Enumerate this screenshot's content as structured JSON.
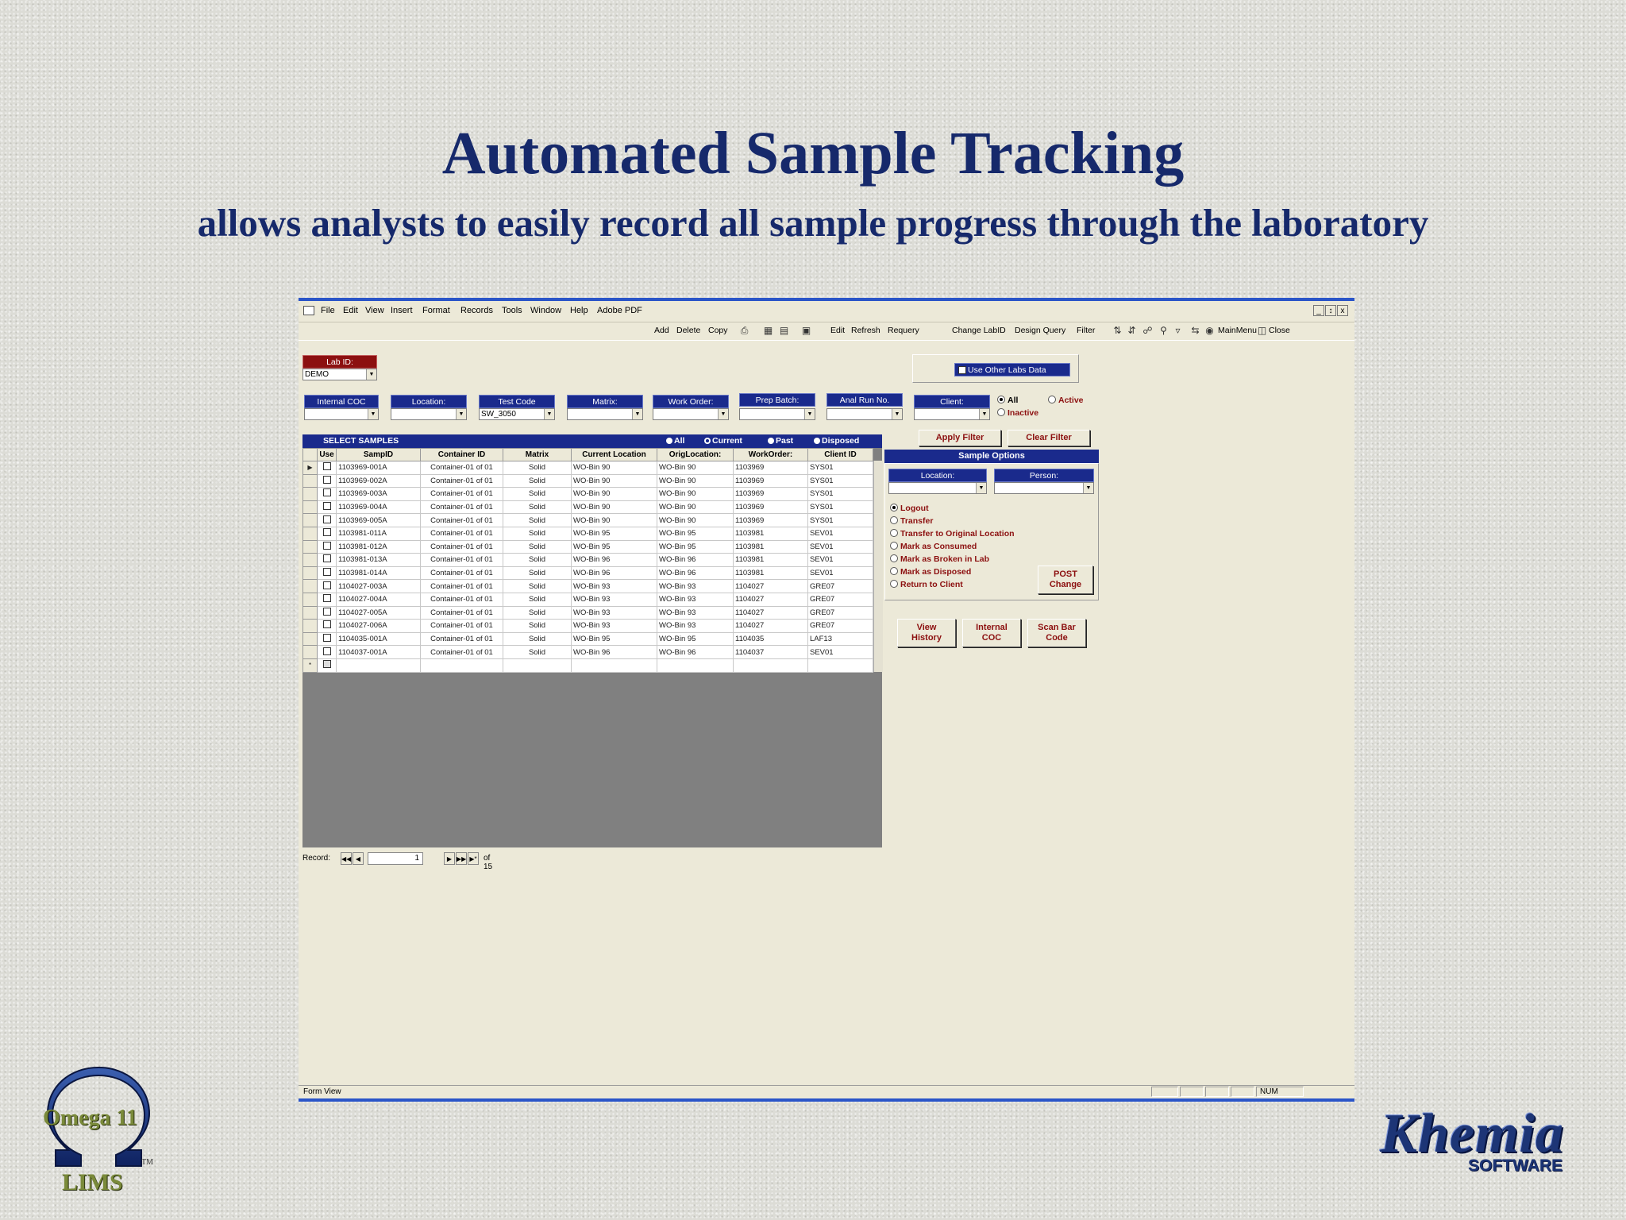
{
  "slide": {
    "title": "Automated Sample Tracking",
    "subtitle": "allows analysts to easily record all sample progress through the laboratory"
  },
  "menu": [
    "File",
    "Edit",
    "View",
    "Insert",
    "Format",
    "Records",
    "Tools",
    "Window",
    "Help",
    "Adobe PDF"
  ],
  "window_controls": [
    "_",
    "↕",
    "x"
  ],
  "toolbar": {
    "add": "Add",
    "delete": "Delete",
    "copy": "Copy",
    "edit": "Edit",
    "refresh": "Refresh",
    "requery": "Requery",
    "change_labid": "Change LabID",
    "design_query": "Design Query",
    "filter": "Filter",
    "mainmenu": "MainMenu",
    "close": "Close"
  },
  "lab_id": {
    "label": "Lab ID:",
    "value": "DEMO"
  },
  "use_other_labs": "Use Other Labs Data",
  "filters": [
    {
      "label": "Internal COC",
      "value": ""
    },
    {
      "label": "Location:",
      "value": ""
    },
    {
      "label": "Test Code",
      "value": "SW_3050"
    },
    {
      "label": "Matrix:",
      "value": ""
    },
    {
      "label": "Work Order:",
      "value": ""
    },
    {
      "label": "Prep Batch:",
      "value": ""
    },
    {
      "label": "Anal Run No.",
      "value": ""
    },
    {
      "label": "Client:",
      "value": ""
    }
  ],
  "status_filter": {
    "all": "All",
    "active": "Active",
    "inactive": "Inactive"
  },
  "apply_filter": "Apply Filter",
  "clear_filter": "Clear Filter",
  "grid": {
    "title": "SELECT   SAMPLES",
    "radios": [
      "All",
      "Current",
      "Past",
      "Disposed"
    ],
    "columns": [
      "Use",
      "SampID",
      "Container ID",
      "Matrix",
      "Current Location",
      "OrigLocation:",
      "WorkOrder:",
      "Client ID"
    ],
    "rows": [
      [
        "1103969-001A",
        "Container-01 of 01",
        "Solid",
        "WO-Bin 90",
        "WO-Bin 90",
        "1103969",
        "SYS01"
      ],
      [
        "1103969-002A",
        "Container-01 of 01",
        "Solid",
        "WO-Bin 90",
        "WO-Bin 90",
        "1103969",
        "SYS01"
      ],
      [
        "1103969-003A",
        "Container-01 of 01",
        "Solid",
        "WO-Bin 90",
        "WO-Bin 90",
        "1103969",
        "SYS01"
      ],
      [
        "1103969-004A",
        "Container-01 of 01",
        "Solid",
        "WO-Bin 90",
        "WO-Bin 90",
        "1103969",
        "SYS01"
      ],
      [
        "1103969-005A",
        "Container-01 of 01",
        "Solid",
        "WO-Bin 90",
        "WO-Bin 90",
        "1103969",
        "SYS01"
      ],
      [
        "1103981-011A",
        "Container-01 of 01",
        "Solid",
        "WO-Bin 95",
        "WO-Bin 95",
        "1103981",
        "SEV01"
      ],
      [
        "1103981-012A",
        "Container-01 of 01",
        "Solid",
        "WO-Bin 95",
        "WO-Bin 95",
        "1103981",
        "SEV01"
      ],
      [
        "1103981-013A",
        "Container-01 of 01",
        "Solid",
        "WO-Bin 96",
        "WO-Bin 96",
        "1103981",
        "SEV01"
      ],
      [
        "1103981-014A",
        "Container-01 of 01",
        "Solid",
        "WO-Bin 96",
        "WO-Bin 96",
        "1103981",
        "SEV01"
      ],
      [
        "1104027-003A",
        "Container-01 of 01",
        "Solid",
        "WO-Bin 93",
        "WO-Bin 93",
        "1104027",
        "GRE07"
      ],
      [
        "1104027-004A",
        "Container-01 of 01",
        "Solid",
        "WO-Bin 93",
        "WO-Bin 93",
        "1104027",
        "GRE07"
      ],
      [
        "1104027-005A",
        "Container-01 of 01",
        "Solid",
        "WO-Bin 93",
        "WO-Bin 93",
        "1104027",
        "GRE07"
      ],
      [
        "1104027-006A",
        "Container-01 of 01",
        "Solid",
        "WO-Bin 93",
        "WO-Bin 93",
        "1104027",
        "GRE07"
      ],
      [
        "1104035-001A",
        "Container-01 of 01",
        "Solid",
        "WO-Bin 95",
        "WO-Bin 95",
        "1104035",
        "LAF13"
      ],
      [
        "1104037-001A",
        "Container-01 of 01",
        "Solid",
        "WO-Bin 96",
        "WO-Bin 96",
        "1104037",
        "SEV01"
      ]
    ]
  },
  "record_nav": {
    "label": "Record:",
    "current": "1",
    "of": "of 15"
  },
  "sample_options": {
    "title": "Sample Options",
    "location_label": "Location:",
    "person_label": "Person:",
    "actions": [
      "Logout",
      "Transfer",
      "Transfer to Original Location",
      "Mark as Consumed",
      "Mark as Broken in Lab",
      "Mark as Disposed",
      "Return to Client"
    ],
    "post_change": [
      "POST",
      "Change"
    ]
  },
  "bottom_buttons": [
    [
      "View",
      "History"
    ],
    [
      "Internal",
      "COC"
    ],
    [
      "Scan Bar",
      "Code"
    ]
  ],
  "status_bar": {
    "view": "Form View",
    "num": "NUM"
  },
  "logos": {
    "omega_top": "Omega 11",
    "omega_bottom": "LIMS",
    "omega_tm": "TM",
    "khemia_main": "Khemia",
    "khemia_sub": "SOFTWARE"
  }
}
